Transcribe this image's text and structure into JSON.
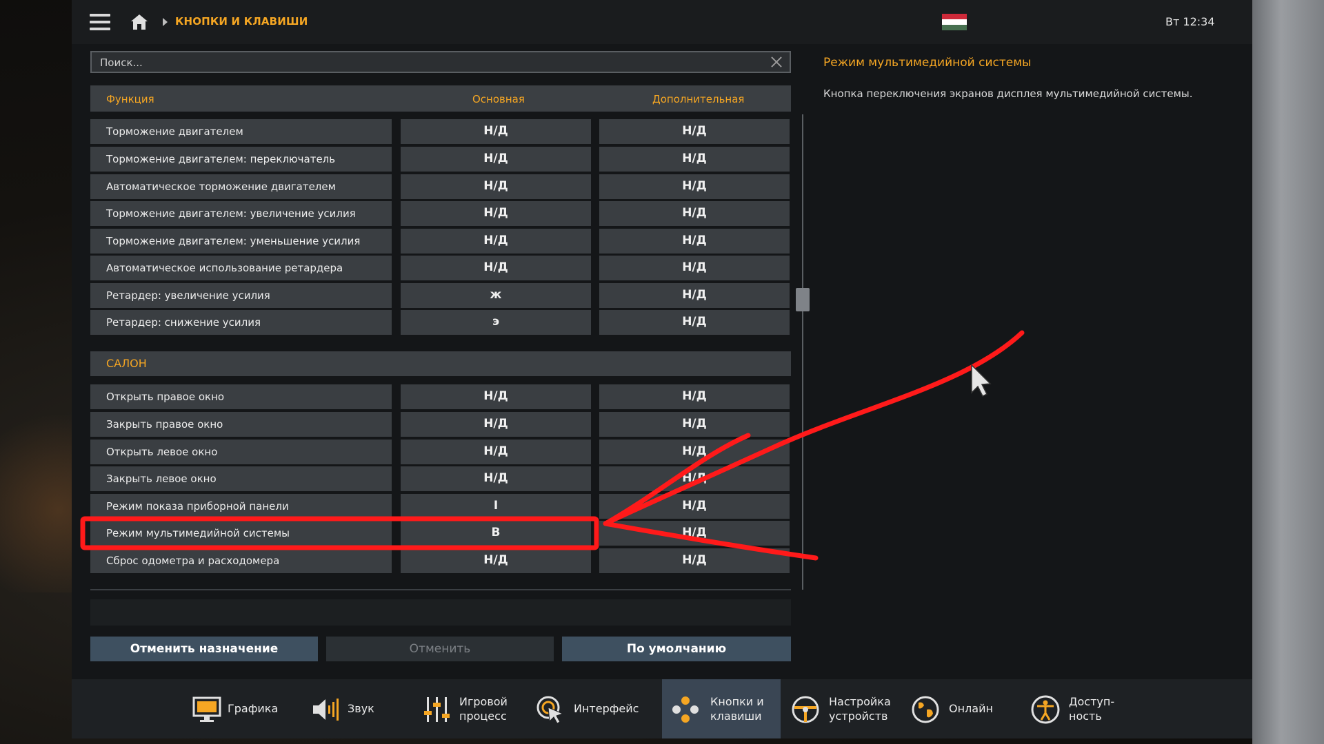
{
  "topbar": {
    "breadcrumb": "КНОПКИ И КЛАВИШИ",
    "time": "Вт 12:34",
    "flag_colors": [
      "#ce2939",
      "#ffffff",
      "#477050"
    ]
  },
  "search": {
    "placeholder": "Поиск..."
  },
  "table": {
    "headers": {
      "function": "Функция",
      "primary": "Основная",
      "secondary": "Дополнительная"
    },
    "rows": [
      {
        "function": "Торможение двигателем",
        "primary": "Н/Д",
        "secondary": "Н/Д"
      },
      {
        "function": "Торможение двигателем: переключатель",
        "primary": "Н/Д",
        "secondary": "Н/Д"
      },
      {
        "function": "Автоматическое торможение двигателем",
        "primary": "Н/Д",
        "secondary": "Н/Д"
      },
      {
        "function": "Торможение двигателем: увеличение усилия",
        "primary": "Н/Д",
        "secondary": "Н/Д"
      },
      {
        "function": "Торможение двигателем: уменьшение усилия",
        "primary": "Н/Д",
        "secondary": "Н/Д"
      },
      {
        "function": "Автоматическое использование ретардера",
        "primary": "Н/Д",
        "secondary": "Н/Д"
      },
      {
        "function": "Ретардер: увеличение усилия",
        "primary": "ж",
        "secondary": "Н/Д"
      },
      {
        "function": "Ретардер: снижение усилия",
        "primary": "э",
        "secondary": "Н/Д"
      }
    ],
    "section": "САЛОН",
    "section_rows": [
      {
        "function": "Открыть правое окно",
        "primary": "Н/Д",
        "secondary": "Н/Д"
      },
      {
        "function": "Закрыть правое окно",
        "primary": "Н/Д",
        "secondary": "Н/Д"
      },
      {
        "function": "Открыть левое окно",
        "primary": "Н/Д",
        "secondary": "Н/Д"
      },
      {
        "function": "Закрыть левое окно",
        "primary": "Н/Д",
        "secondary": "Н/Д"
      },
      {
        "function": "Режим показа приборной панели",
        "primary": "I",
        "secondary": "Н/Д"
      },
      {
        "function": "Режим мультимедийной системы",
        "primary": "B",
        "secondary": "Н/Д"
      },
      {
        "function": "Сброс одометра и расходомера",
        "primary": "Н/Д",
        "secondary": "Н/Д"
      }
    ]
  },
  "buttons": {
    "unassign": "Отменить назначение",
    "cancel": "Отменить",
    "defaults": "По умолчанию"
  },
  "details": {
    "title": "Режим мультимедийной системы",
    "description": "Кнопка переключения экранов дисплея мультимедийной системы."
  },
  "nav": {
    "graphics": "Графика",
    "sound": "Звук",
    "gameplay_1": "Игровой",
    "gameplay_2": "процесс",
    "interface": "Интерфейс",
    "keys_1": "Кнопки и",
    "keys_2": "клавиши",
    "devices_1": "Настройка",
    "devices_2": "устройств",
    "online": "Онлайн",
    "access_1": "Доступ-",
    "access_2": "ность"
  },
  "colors": {
    "accent": "#f5a623",
    "annotation": "#ff1a1a",
    "active_nav": "#3a4654"
  }
}
